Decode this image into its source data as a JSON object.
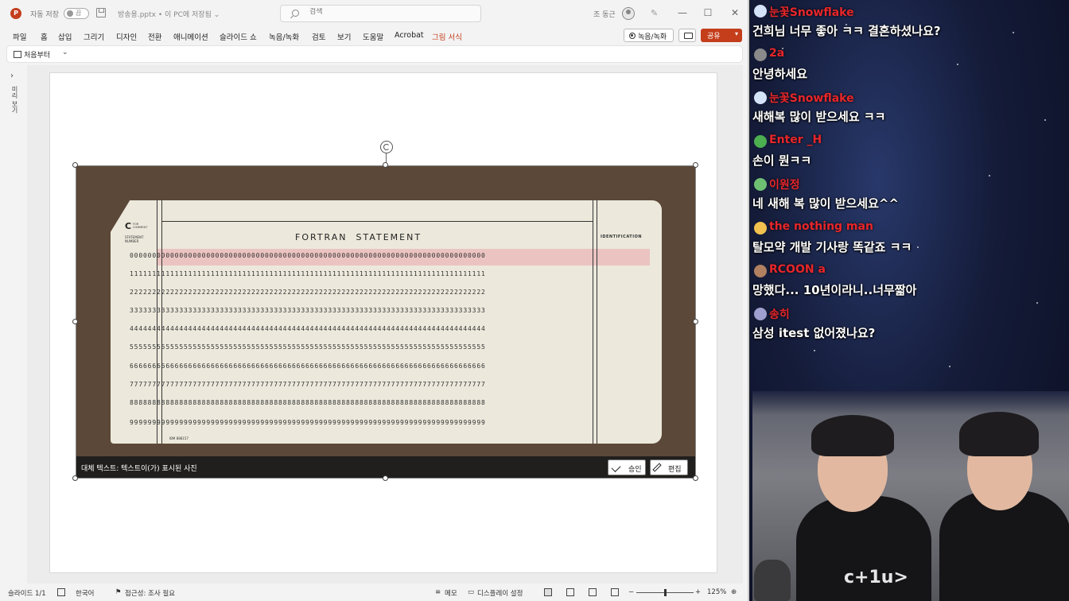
{
  "app": {
    "logo_letter": "P",
    "autosave_label": "자동 저장",
    "autosave_state": "끔",
    "filename": "방송용.pptx • 이 PC에 저장됨 ⌄",
    "search_placeholder": "검색",
    "user_name": "조 동근"
  },
  "menu": {
    "tabs": [
      "파일",
      "홈",
      "삽입",
      "그리기",
      "디자인",
      "전환",
      "애니메이션",
      "슬라이드 쇼",
      "녹음/녹화",
      "검토",
      "보기",
      "도움말",
      "Acrobat",
      "그림 서식"
    ],
    "record_label": "녹음/녹화",
    "share_label": "공유"
  },
  "ribbon": {
    "from_start_label": "처음부터",
    "more": "⌄"
  },
  "rail": {
    "label": "미리 보기"
  },
  "card": {
    "title": "FORTRAN  STATEMENT",
    "identification": "IDENTIFICATION",
    "c_mark": "C",
    "c_sub": "FOR\nCOMMENT",
    "statement_number": "STATEMENT\nNUMBER",
    "serial": "IBM 888157",
    "rows": [
      "0000000000000000000000000000000000000000000000000000000000000000000000000000000",
      "1111111111111111111111111111111111111111111111111111111111111111111111111111111",
      "2222222222222222222222222222222222222222222222222222222222222222222222222222222",
      "3333333333333333333333333333333333333333333333333333333333333333333333333333333",
      "4444444444444444444444444444444444444444444444444444444444444444444444444444444",
      "5555555555555555555555555555555555555555555555555555555555555555555555555555555",
      "6666666666666666666666666666666666666666666666666666666666666666666666666666666",
      "7777777777777777777777777777777777777777777777777777777777777777777777777777777",
      "8888888888888888888888888888888888888888888888888888888888888888888888888888888",
      "9999999999999999999999999999999999999999999999999999999999999999999999999999999"
    ]
  },
  "alt_text": {
    "text": "대체 텍스트: 텍스트이(가) 표시된 사진",
    "approve_label": "승인",
    "edit_label": "편집"
  },
  "status": {
    "slide": "슬라이드 1/1",
    "language": "한국어",
    "accessibility": "접근성: 조사 필요",
    "notes": "메모",
    "display_settings": "디스플레이 설정",
    "zoom_minus": "−",
    "zoom_plus": "+",
    "zoom": "125%"
  },
  "chat": [
    {
      "user": "눈꽃Snowflake",
      "text": "건희님 너무 좋아 ㅋㅋ 결혼하셨나요?",
      "avatar_color": "#d4e3f7"
    },
    {
      "user": "2a",
      "text": "안녕하세요",
      "avatar_color": "#8a8a8a"
    },
    {
      "user": "눈꽃Snowflake",
      "text": "새해복 많이 받으세요 ㅋㅋ",
      "avatar_color": "#d4e3f7"
    },
    {
      "user": "Enter _H",
      "text": "손이 뭔ㅋㅋ",
      "avatar_color": "#4caf50"
    },
    {
      "user": "이원정",
      "text": "네 새해 복 많이 받으세요^^",
      "avatar_color": "#6fbf73"
    },
    {
      "user": "the nothing man",
      "text": "탈모약 개발 기사랑 똑같죠 ㅋㅋ",
      "avatar_color": "#f2c14e"
    },
    {
      "user": "RCOON a",
      "text": "망했다... 10년이라니..너무짧아",
      "avatar_color": "#b08060"
    },
    {
      "user": "송히",
      "text": "삼성 itest 없어졌나요?",
      "avatar_color": "#a0a0d0"
    }
  ],
  "webcam": {
    "shirt_text": "c+1u>"
  }
}
